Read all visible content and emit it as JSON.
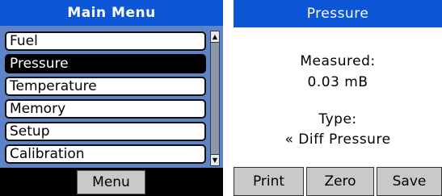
{
  "main_menu": {
    "title": "Main Menu",
    "items": [
      {
        "label": "Fuel",
        "selected": false
      },
      {
        "label": "Pressure",
        "selected": true
      },
      {
        "label": "Temperature",
        "selected": false
      },
      {
        "label": "Memory",
        "selected": false
      },
      {
        "label": "Setup",
        "selected": false
      },
      {
        "label": "Calibration",
        "selected": false
      }
    ],
    "softkey_label": "Menu"
  },
  "pressure_screen": {
    "title": "Pressure",
    "measured_label": "Measured:",
    "measured_value": "0.03 mB",
    "type_label": "Type:",
    "type_value": "« Diff Pressure",
    "softkeys": [
      "Print",
      "Zero",
      "Save"
    ]
  },
  "colors": {
    "title_bar": "#0b55d6",
    "menu_background": "#5e84c6",
    "softkey": "#c9c9c9"
  },
  "icons": {
    "scroll_up": "scroll-up-arrow-icon",
    "scroll_down": "scroll-down-arrow-icon"
  }
}
